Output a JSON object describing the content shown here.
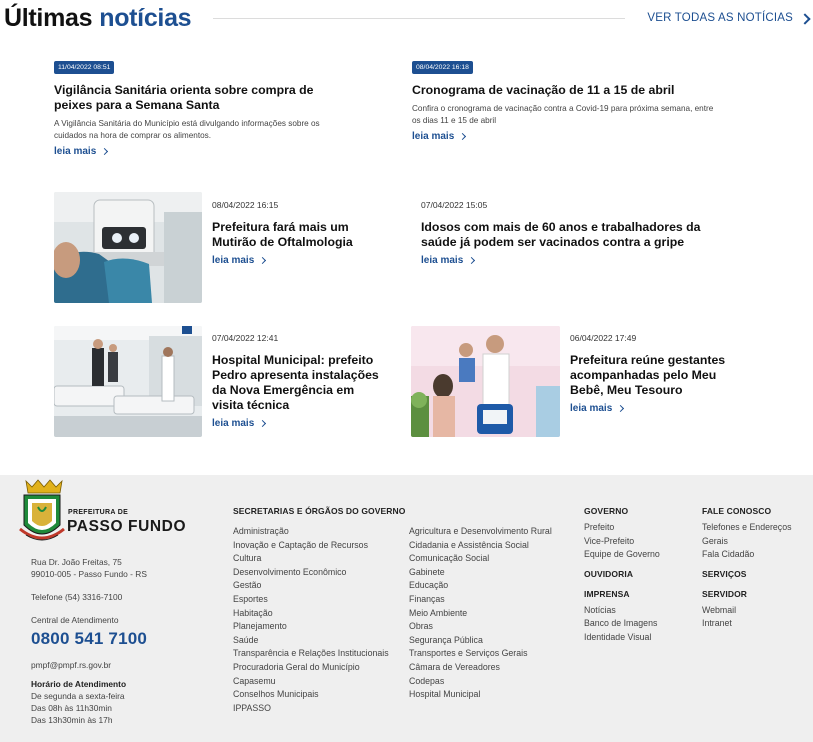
{
  "header": {
    "title_part1": "Últimas",
    "title_part2": "notícias",
    "see_all": "VER TODAS AS NOTÍCIAS"
  },
  "news": [
    {
      "date": "11/04/2022 08:51",
      "title": "Vigilância Sanitária orienta sobre compra de peixes para a Semana Santa",
      "summary": "A Vigilância Sanitária do Município está divulgando informações sobre os cuidados na hora de comprar os alimentos.",
      "more": "leia mais"
    },
    {
      "date": "08/04/2022 16:18",
      "title": "Cronograma de vacinação de 11 a 15 de abril",
      "summary": "Confira o cronograma de vacinação contra a Covid-19 para próxima semana, entre os dias 11 e 15 de abril",
      "more": "leia mais"
    },
    {
      "date": "08/04/2022 16:15",
      "title": "Prefeitura fará mais um Mutirão de Oftalmologia",
      "more": "leia mais"
    },
    {
      "date": "07/04/2022 15:05",
      "title": "Idosos com mais de 60 anos e trabalhadores da saúde já podem ser vacinados contra a gripe",
      "more": "leia mais"
    },
    {
      "date": "07/04/2022 12:41",
      "title": "Hospital Municipal: prefeito Pedro apresenta instalações da Nova Emergência em visita técnica",
      "more": "leia mais"
    },
    {
      "date": "06/04/2022 17:49",
      "title": "Prefeitura reúne gestantes acompanhadas pelo Meu Bebê, Meu Tesouro",
      "more": "leia mais"
    }
  ],
  "footer": {
    "brand_top": "PREFEITURA DE",
    "brand_name": "PASSO FUNDO",
    "address1": "Rua Dr. João Freitas, 75",
    "address2": "99010-005 - Passo Fundo - RS",
    "phone": "Telefone (54) 3316-7100",
    "service_label": "Central de Atendimento",
    "service_phone": "0800 541 7100",
    "email": "pmpf@pmpf.rs.gov.br",
    "hours_title": "Horário de Atendimento",
    "hours1": "De segunda a sexta-feira",
    "hours2": "Das 08h às 11h30min",
    "hours3": "Das 13h30min às 17h",
    "secretarias_title": "SECRETARIAS E ÓRGÃOS DO GOVERNO",
    "secretarias_col1": [
      "Administração",
      "Inovação e Captação de Recursos",
      "Cultura",
      "Desenvolvimento Econômico",
      "Gestão",
      "Esportes",
      "Habitação",
      "Planejamento",
      "Saúde",
      "Transparência e Relações Institucionais",
      "Procuradoria Geral do Município",
      "Capasemu",
      "Conselhos Municipais",
      "IPPASSO"
    ],
    "secretarias_col2": [
      "Agricultura e Desenvolvimento Rural",
      "Cidadania e Assistência Social",
      "Comunicação Social",
      "Gabinete",
      "Educação",
      "Finanças",
      "Meio Ambiente",
      "Obras",
      "Segurança Pública",
      "Transportes e Serviços Gerais",
      "Câmara de Vereadores",
      "Codepas",
      "Hospital Municipal"
    ],
    "governo_title": "GOVERNO",
    "governo": [
      "Prefeito",
      "Vice-Prefeito",
      "Equipe de Governo"
    ],
    "ouvidoria_title": "OUVIDORIA",
    "imprensa_title": "IMPRENSA",
    "imprensa": [
      "Notícias",
      "Banco de Imagens",
      "Identidade Visual"
    ],
    "fale_title": "FALE CONOSCO",
    "fale": [
      "Telefones e Endereços Gerais",
      "Fala Cidadão"
    ],
    "servicos_title": "SERVIÇOS",
    "servidor_title": "SERVIDOR",
    "servidor": [
      "Webmail",
      "Intranet"
    ]
  }
}
